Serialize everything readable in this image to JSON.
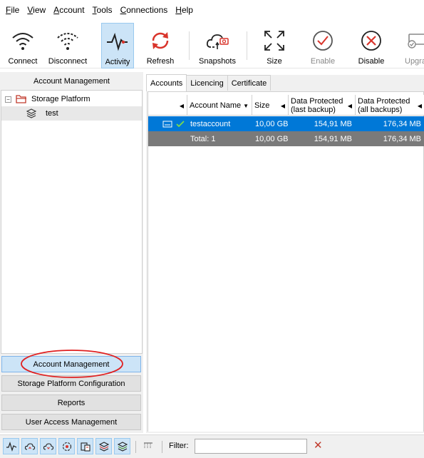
{
  "menu": [
    {
      "key": "F",
      "rest": "ile"
    },
    {
      "key": "V",
      "rest": "iew"
    },
    {
      "key": "A",
      "rest": "ccount"
    },
    {
      "key": "T",
      "rest": "ools"
    },
    {
      "key": "C",
      "rest": "onnections"
    },
    {
      "key": "H",
      "rest": "elp"
    }
  ],
  "toolbar": {
    "connect": "Connect",
    "disconnect": "Disconnect",
    "activity": "Activity",
    "refresh": "Refresh",
    "snapshots": "Snapshots",
    "size": "Size",
    "enable": "Enable",
    "disable": "Disable",
    "upgrade": "Upgra"
  },
  "left": {
    "header": "Account Management",
    "tree": {
      "root": "Storage Platform",
      "root_expander": "−",
      "child": "test"
    },
    "nav": {
      "account_management": "Account Management",
      "storage_platform_configuration": "Storage Platform Configuration",
      "reports": "Reports",
      "user_access_management": "User Access Management"
    }
  },
  "tabs": {
    "accounts": "Accounts",
    "licencing": "Licencing",
    "certificate": "Certificate"
  },
  "grid": {
    "headers": {
      "account_name": "Account Name",
      "size": "Size",
      "dp_last_1": "Data Protected",
      "dp_last_2": "(last backup)",
      "dp_all_1": "Data Protected",
      "dp_all_2": "(all backups)"
    },
    "rows": [
      {
        "name": "testaccount",
        "size": "10,00 GB",
        "dp_last": "154,91 MB",
        "dp_all": "176,34 MB"
      }
    ],
    "total": {
      "label": "Total: 1",
      "size": "10,00 GB",
      "dp_last": "154,91 MB",
      "dp_all": "176,34 MB"
    }
  },
  "bottom": {
    "filter_label": "Filter:",
    "filter_value": "",
    "filter_clear": "✕"
  },
  "colors": {
    "selection": "#0078d7",
    "active_button": "#cce4f7",
    "annotation_red": "#e02020",
    "refresh_red": "#d9342b"
  }
}
